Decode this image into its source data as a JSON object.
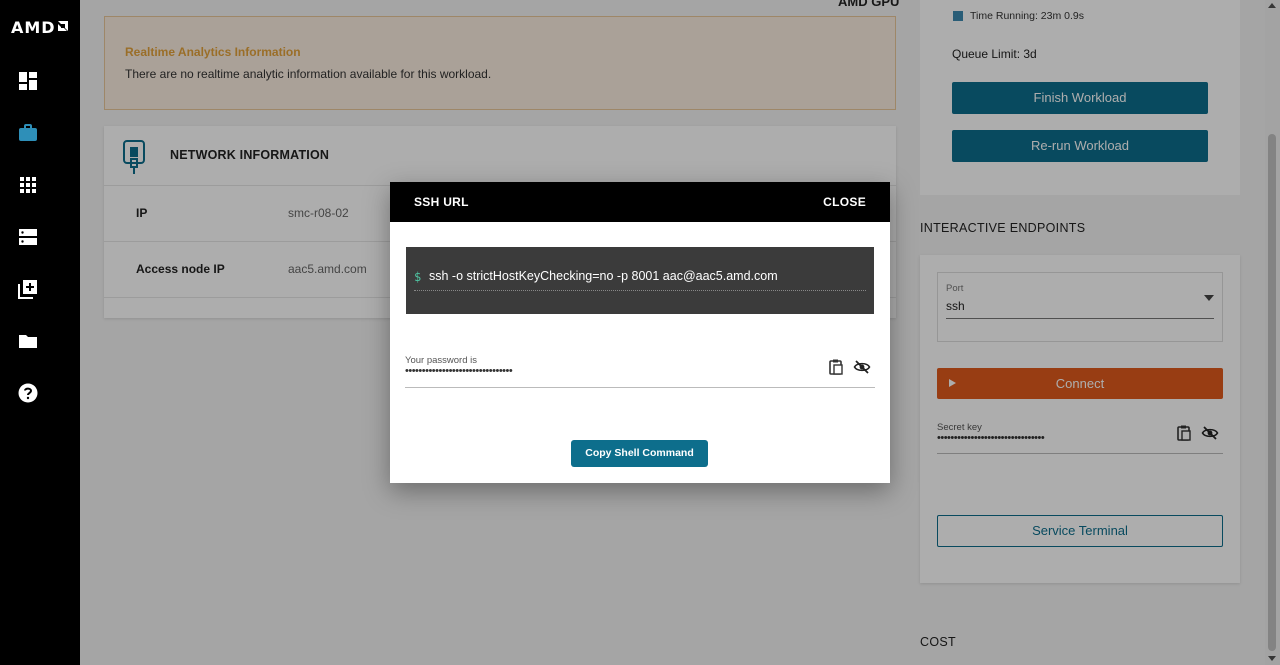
{
  "sidebar": {
    "logo": "AMD",
    "items": [
      {
        "name": "dashboard-icon"
      },
      {
        "name": "briefcase-icon"
      },
      {
        "name": "apps-grid-icon"
      },
      {
        "name": "servers-icon"
      },
      {
        "name": "add-library-icon"
      },
      {
        "name": "folder-icon"
      },
      {
        "name": "help-icon"
      }
    ]
  },
  "top_cut_text": "AMD GPU",
  "realtime": {
    "title": "Realtime Analytics Information",
    "text": "There are no realtime analytic information available for this workload."
  },
  "network": {
    "title": "NETWORK INFORMATION",
    "rows": [
      {
        "key": "IP",
        "value": "smc-r08-02"
      },
      {
        "key": "Access node IP",
        "value": "aac5.amd.com"
      }
    ]
  },
  "status": {
    "time_running": "Time Running: 23m 0.9s",
    "queue_limit": "Queue Limit: 3d",
    "finish_label": "Finish Workload",
    "rerun_label": "Re-run Workload"
  },
  "endpoints": {
    "title": "INTERACTIVE ENDPOINTS",
    "port_label": "Port",
    "port_value": "ssh",
    "connect_label": "Connect",
    "secret_label": "Secret key",
    "secret_dots": "••••••••••••••••••••••••••••••••",
    "service_terminal_label": "Service Terminal"
  },
  "cost_title": "COST",
  "modal": {
    "title": "SSH URL",
    "close_label": "CLOSE",
    "prompt": "$",
    "command": "ssh -o strictHostKeyChecking=no -p 8001 aac@aac5.amd.com",
    "password_label": "Your password is",
    "password_dots": "••••••••••••••••••••••••••••••••",
    "copy_button_label": "Copy Shell Command"
  },
  "colors": {
    "accent_teal": "#0d6e8c",
    "connect_orange": "#e05a1c",
    "warning_title": "#e4a23b"
  }
}
